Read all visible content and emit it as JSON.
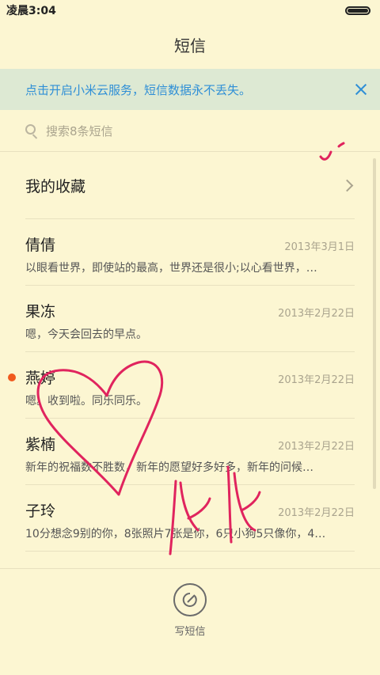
{
  "status_bar": {
    "time": "凌晨3:04"
  },
  "header": {
    "title": "短信"
  },
  "banner": {
    "text": "点击开启小米云服务，短信数据永不丢失。"
  },
  "search": {
    "placeholder": "搜索8条短信"
  },
  "favorites": {
    "label": "我的收藏"
  },
  "messages": [
    {
      "name": "倩倩",
      "date": "2013年3月1日",
      "preview": "以眼看世界，即使站的最高，世界还是很小;以心看世界，…",
      "unread": false
    },
    {
      "name": "果冻",
      "date": "2013年2月22日",
      "preview": "嗯，今天会回去的早点。",
      "unread": false
    },
    {
      "name": "燕婷",
      "date": "2013年2月22日",
      "preview": "嗯。收到啦。同乐同乐。",
      "unread": true
    },
    {
      "name": "紫楠",
      "date": "2013年2月22日",
      "preview": "新年的祝福数不胜数，新年的愿望好多好多，新年的问候…",
      "unread": false
    },
    {
      "name": "子玲",
      "date": "2013年2月22日",
      "preview": "10分想念9别的你，8张照片7张是你，6只小狗5只像你，4…",
      "unread": false
    }
  ],
  "compose": {
    "label": "写短信"
  },
  "colors": {
    "background": "#fcf6d2",
    "banner_bg": "#dde9d3",
    "accent": "#2f8fd6",
    "unread_dot": "#f05a1e",
    "doodle": "#e0245e"
  },
  "icons": {
    "search": "search-icon",
    "close": "close-icon",
    "chevron": "chevron-right-icon",
    "compose": "compose-icon",
    "battery": "battery-icon"
  }
}
